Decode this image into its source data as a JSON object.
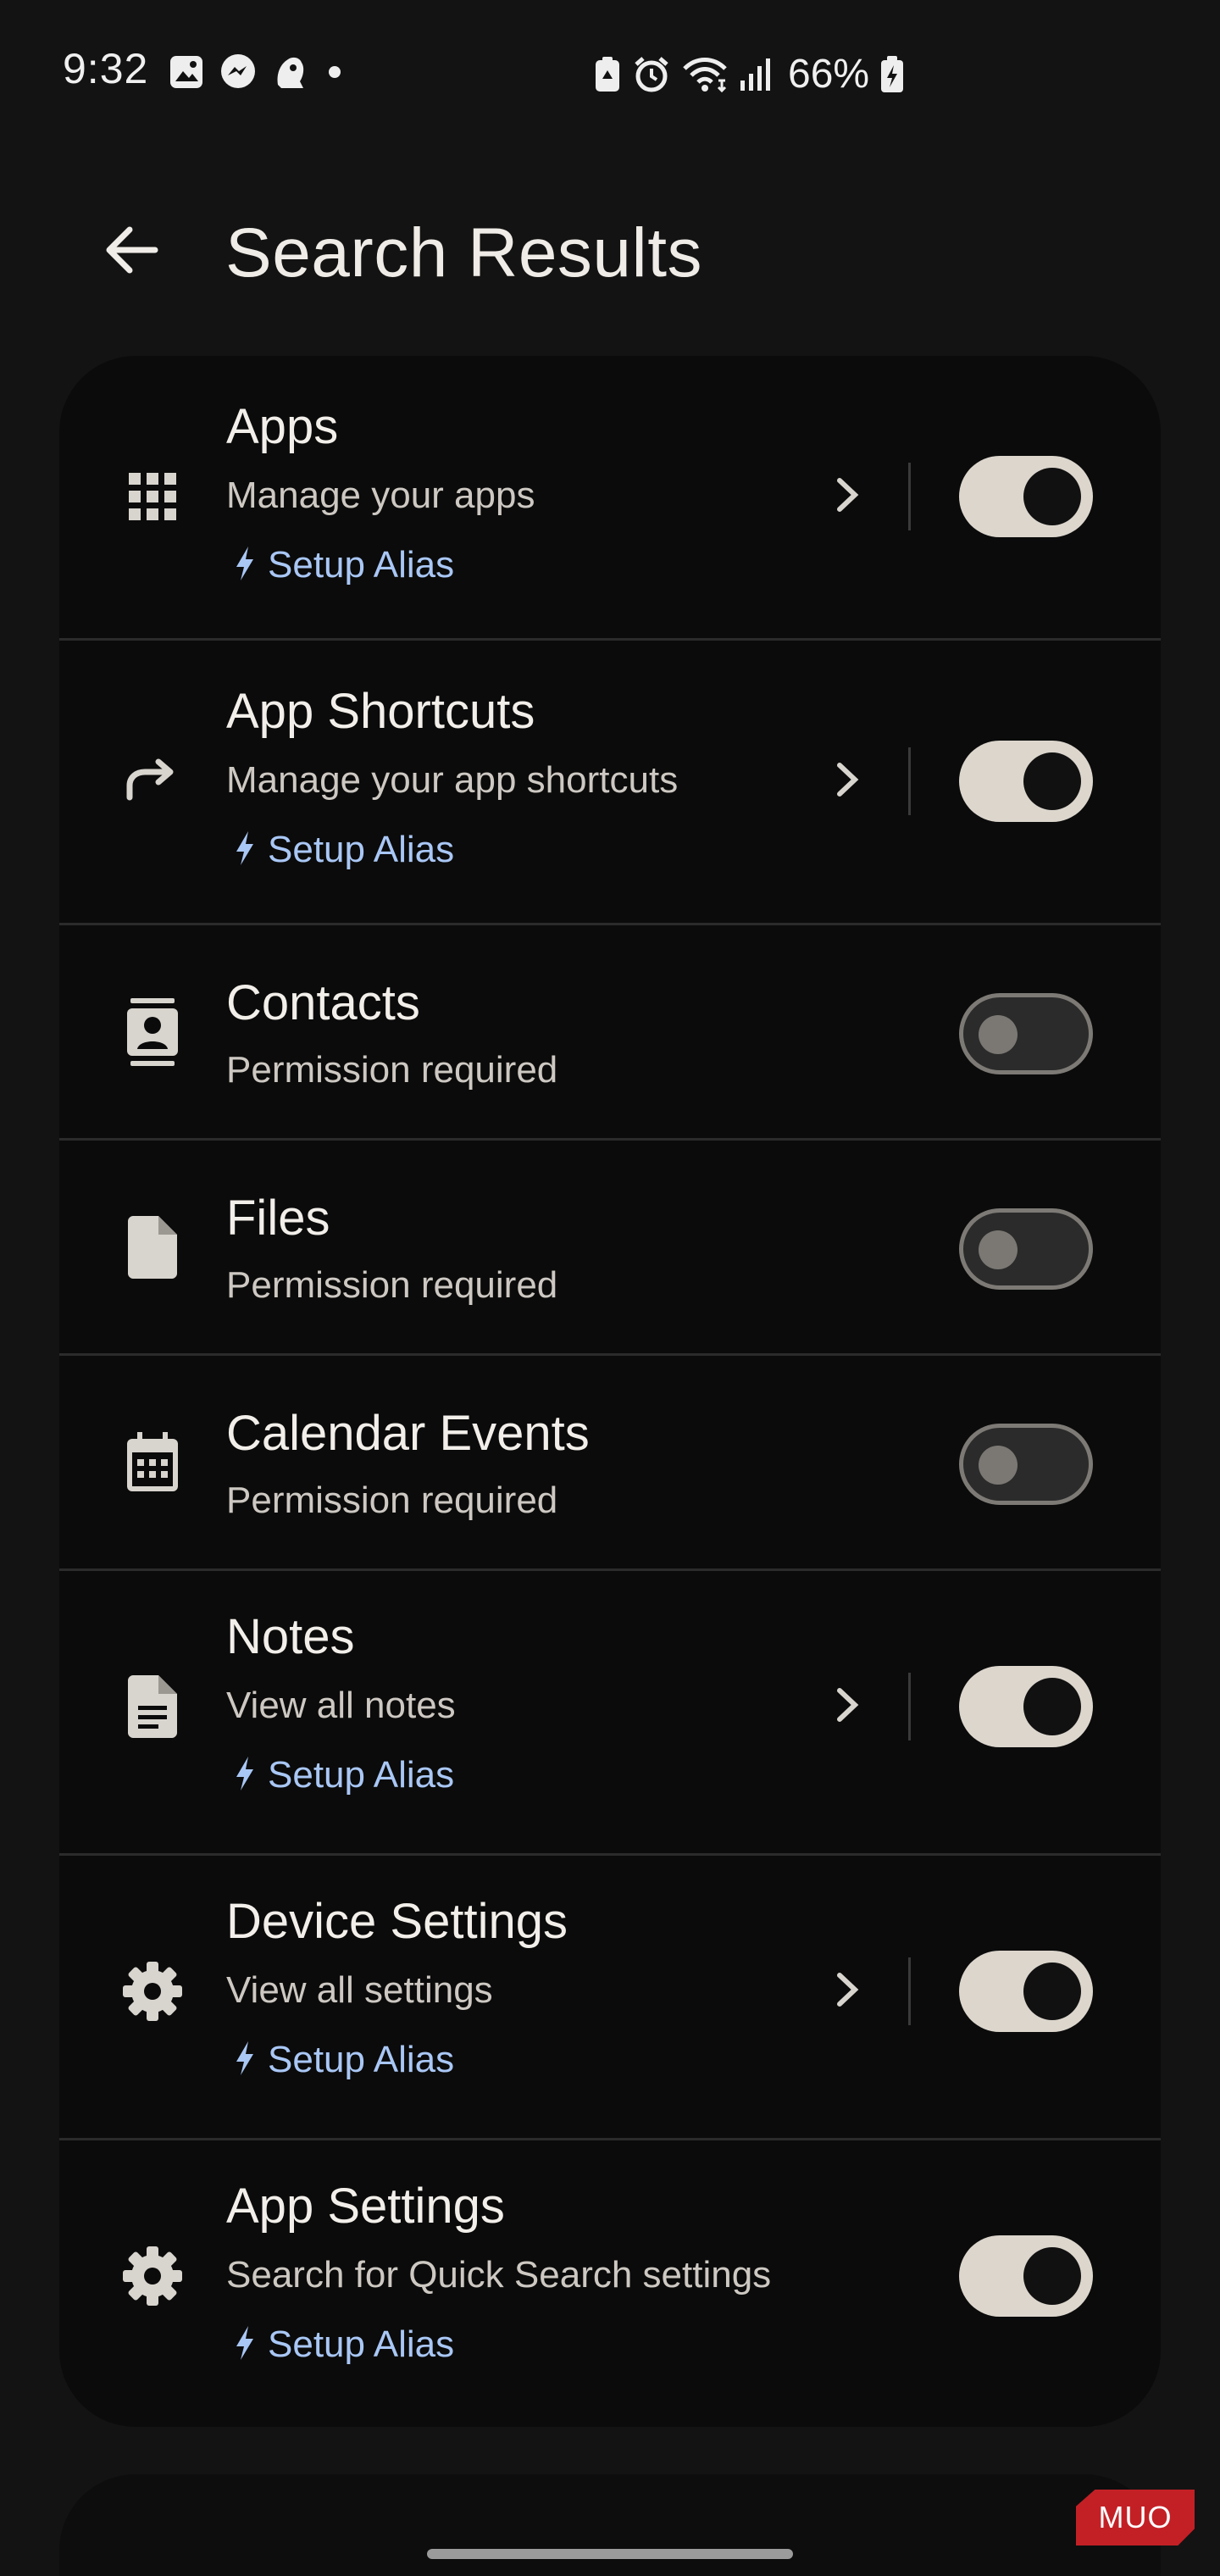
{
  "status_bar": {
    "time": "9:32",
    "left_icons": [
      "gallery-icon",
      "messenger-icon",
      "premier-league-icon",
      "dot-icon"
    ],
    "right_icons": [
      "battery-saver-icon",
      "alarm-icon",
      "wifi-icon",
      "signal-icon",
      "battery-charging-icon"
    ],
    "battery": "66%"
  },
  "header": {
    "title": "Search Results",
    "back_icon": "arrow-back-icon"
  },
  "colors": {
    "background": "#131313",
    "card": "#0b0b0b",
    "accent_link": "#a9c7f5",
    "toggle_on": "#dcd6cd"
  },
  "items": [
    {
      "title": "Apps",
      "subtitle": "Manage your apps",
      "icon": "apps-grid-icon",
      "alias": "Setup Alias",
      "has_chevron": true,
      "enabled": true
    },
    {
      "title": "App Shortcuts",
      "subtitle": "Manage your app shortcuts",
      "icon": "shortcut-arrow-icon",
      "alias": "Setup Alias",
      "has_chevron": true,
      "enabled": true
    },
    {
      "title": "Contacts",
      "subtitle": "Permission required",
      "icon": "contacts-icon",
      "alias": "",
      "has_chevron": false,
      "enabled": false
    },
    {
      "title": "Files",
      "subtitle": "Permission required",
      "icon": "file-icon",
      "alias": "",
      "has_chevron": false,
      "enabled": false
    },
    {
      "title": "Calendar Events",
      "subtitle": "Permission required",
      "icon": "calendar-icon",
      "alias": "",
      "has_chevron": false,
      "enabled": false
    },
    {
      "title": "Notes",
      "subtitle": "View all notes",
      "icon": "note-icon",
      "alias": "Setup Alias",
      "has_chevron": true,
      "enabled": true
    },
    {
      "title": "Device Settings",
      "subtitle": "View all settings",
      "icon": "gear-icon",
      "alias": "Setup Alias",
      "has_chevron": true,
      "enabled": true
    },
    {
      "title": "App Settings",
      "subtitle": "Search for Quick Search settings",
      "icon": "gear-icon",
      "alias": "Setup Alias",
      "has_chevron": false,
      "enabled": true
    }
  ],
  "watermark": "MUO"
}
